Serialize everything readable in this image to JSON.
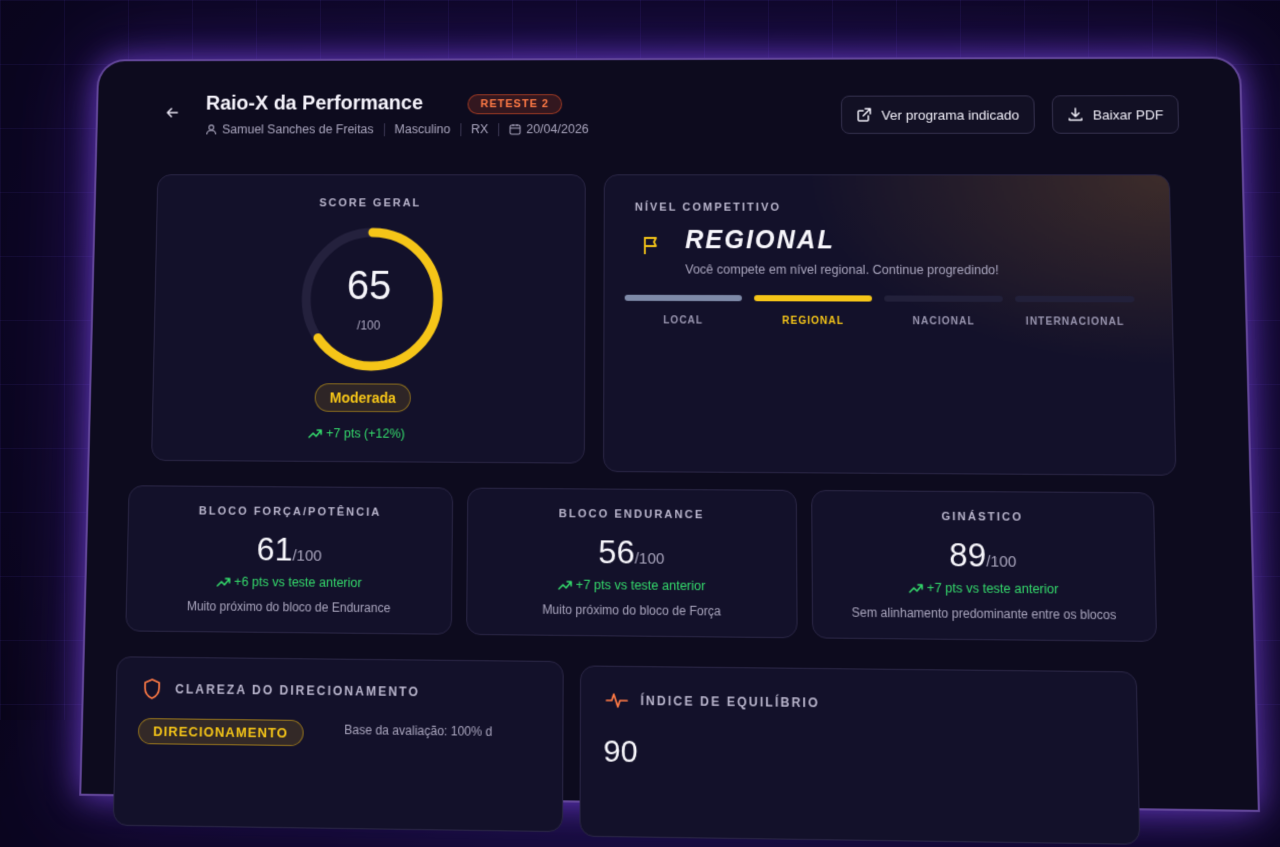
{
  "header": {
    "title": "Raio-X da Performance",
    "badge": "RETESTE 2",
    "athlete": "Samuel Sanches de Freitas",
    "gender": "Masculino",
    "category": "RX",
    "date": "20/04/2026",
    "btn_program": "Ver programa indicado",
    "btn_pdf": "Baixar PDF"
  },
  "score": {
    "label": "SCORE GERAL",
    "value": "65",
    "max": "/100",
    "fraction": 0.65,
    "classification": "Moderada",
    "delta": "+7 pts (+12%)"
  },
  "nivel": {
    "label": "NÍVEL COMPETITIVO",
    "title": "REGIONAL",
    "description": "Você compete em nível regional. Continue progredindo!",
    "levels": [
      "LOCAL",
      "REGIONAL",
      "NACIONAL",
      "INTERNACIONAL"
    ],
    "current_index": 1
  },
  "blocks": [
    {
      "label": "BLOCO FORÇA/POTÊNCIA",
      "value": "61",
      "max": "/100",
      "delta": "+6 pts vs teste anterior",
      "note": "Muito próximo do bloco de Endurance"
    },
    {
      "label": "BLOCO ENDURANCE",
      "value": "56",
      "max": "/100",
      "delta": "+7 pts vs teste anterior",
      "note": "Muito próximo do bloco de Força"
    },
    {
      "label": "GINÁSTICO",
      "value": "89",
      "max": "/100",
      "delta": "+7 pts vs teste anterior",
      "note": "Sem alinhamento predominante entre os blocos"
    }
  ],
  "clareza": {
    "label": "CLAREZA DO DIRECIONAMENTO",
    "badge": "DIRECIONAMENTO",
    "note": "Base da avaliação: 100% d"
  },
  "equilibrio": {
    "label": "ÍNDICE DE EQUILÍBRIO",
    "value": "90"
  },
  "colors": {
    "accent": "#f5c518",
    "positive": "#34d96b",
    "reteste": "#ff7a45",
    "glow": "#8c50ff"
  }
}
